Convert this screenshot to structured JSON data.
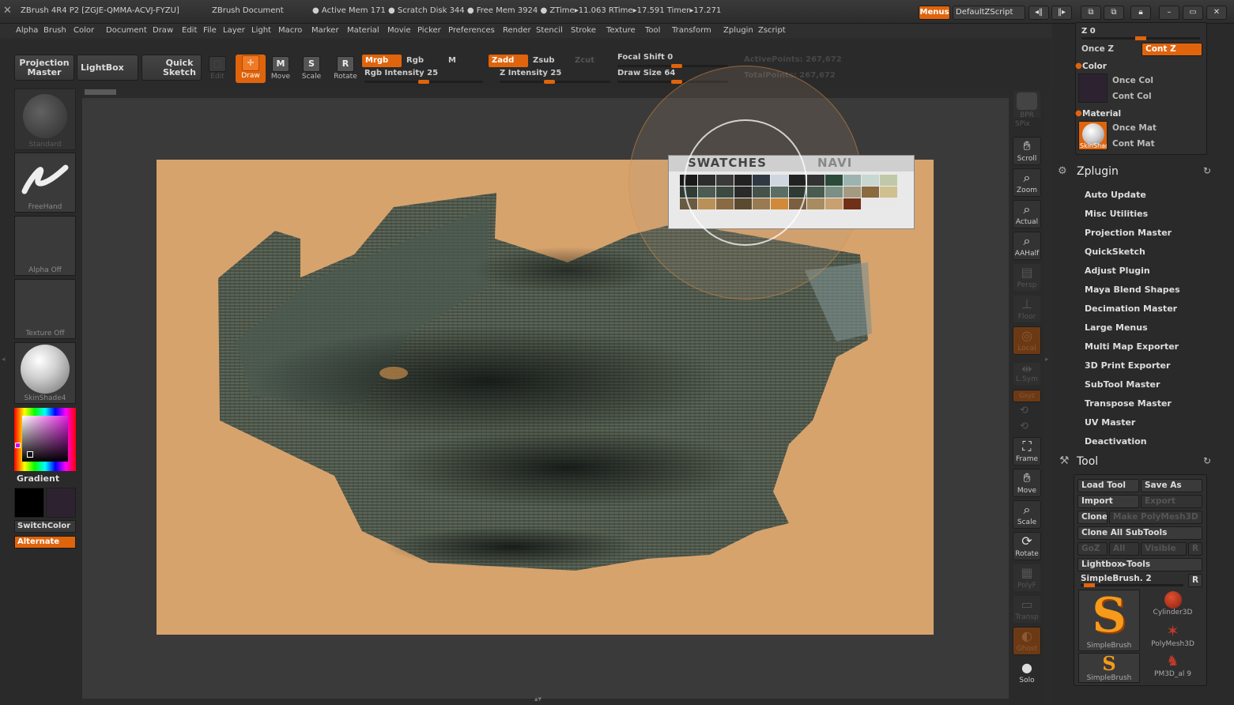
{
  "titlebar": {
    "app": "ZBrush 4R4 P2 [ZGJE-QMMA-ACVJ-FYZU]",
    "document": "ZBrush Document",
    "stats": "● Active Mem 171  ● Scratch Disk 344  ● Free Mem 3924  ● ZTime▸11.063 RTime▸17.591  Timer▸17.271",
    "menus_label": "Menus",
    "script_label": "DefaultZScript"
  },
  "menubar": [
    "Alpha",
    "Brush",
    "Color",
    "Document",
    "Draw",
    "Edit",
    "File",
    "Layer",
    "Light",
    "Macro",
    "Marker",
    "Material",
    "Movie",
    "Picker",
    "Preferences",
    "Render",
    "Stencil",
    "Stroke",
    "Texture",
    "Tool",
    "Transform",
    "Zplugin",
    "Zscript"
  ],
  "shelf": {
    "projection_master": "Projection\nMaster",
    "lightbox": "LightBox",
    "quick_sketch": "Quick\nSketch",
    "edit": "Edit",
    "draw": "Draw",
    "move": "Move",
    "scale": "Scale",
    "rotate": "Rotate",
    "mrgb": "Mrgb",
    "rgb": "Rgb",
    "m": "M",
    "zadd": "Zadd",
    "zsub": "Zsub",
    "zcut": "Zcut",
    "rgb_intensity": "Rgb Intensity 25",
    "z_intensity": "Z Intensity 25",
    "focal_shift": "Focal Shift 0",
    "draw_size": "Draw Size 64",
    "active_points": "ActivePoints: 267,672",
    "total_points": "TotalPoints: 267,672",
    "rgb_intensity_value": 25,
    "z_intensity_value": 25,
    "focal_shift_value": 0,
    "draw_size_value": 64
  },
  "lefttray": {
    "standard": "Standard",
    "freehand": "FreeHand",
    "alpha": "Alpha  Off",
    "texture": "Texture  Off",
    "material": "SkinShade4",
    "gradient": "Gradient",
    "switchcolor": "SwitchColor",
    "alternate": "Alternate"
  },
  "swatches": {
    "title": "SWATCHES",
    "nav": "NAVI"
  },
  "rightbar": {
    "bpr": "BPR",
    "spix": "SPix",
    "scroll": "Scroll",
    "zoom": "Zoom",
    "actual": "Actual",
    "aahalf": "AAHalf",
    "persp": "Persp",
    "floor": "Floor",
    "local": "Local",
    "lsym": "L.Sym",
    "xyz": "Gxyz",
    "frame": "Frame",
    "move": "Move",
    "scale": "Scale",
    "rotate": "Rotate",
    "polyf": "PolyF",
    "transp": "Transp",
    "ghost": "Ghost",
    "solo": "Solo"
  },
  "rightpanel": {
    "z0": "Z 0",
    "once_z": "Once Z",
    "cont_z": "Cont Z",
    "color_header": "Color",
    "once_col": "Once Col",
    "cont_col": "Cont Col",
    "material_header": "Material",
    "once_mat": "Once Mat",
    "cont_mat": "Cont Mat",
    "mat_thumb": "SkinShad",
    "zplugin_title": "Zplugin",
    "zplugin_items": [
      "Auto Update",
      "Misc Utilities",
      "Projection Master",
      "QuickSketch",
      "Adjust Plugin",
      "Maya Blend Shapes",
      "Decimation Master",
      "Large Menus",
      "Multi Map Exporter",
      "3D Print Exporter",
      "SubTool Master",
      "Transpose Master",
      "UV Master",
      "Deactivation"
    ],
    "tool_title": "Tool",
    "load_tool": "Load Tool",
    "save_as": "Save As",
    "import": "Import",
    "export": "Export",
    "clone": "Clone",
    "make_polymesh": "Make PolyMesh3D",
    "clone_all": "Clone  All SubTools",
    "goz": "GoZ",
    "all": "All",
    "visible": "Visible",
    "r": "R",
    "lightbox_tools": "Lightbox▸Tools",
    "simplebrush_slider": "SimpleBrush. 2",
    "r2": "R",
    "thumbs": [
      "SimpleBrush",
      "Cylinder3D",
      "PolyMesh3D",
      "SimpleBrush",
      "PM3D_al 9"
    ]
  },
  "colors": {
    "accent": "#e0640c",
    "canvas": "#d7a36d",
    "paint": "#4f5e55"
  }
}
